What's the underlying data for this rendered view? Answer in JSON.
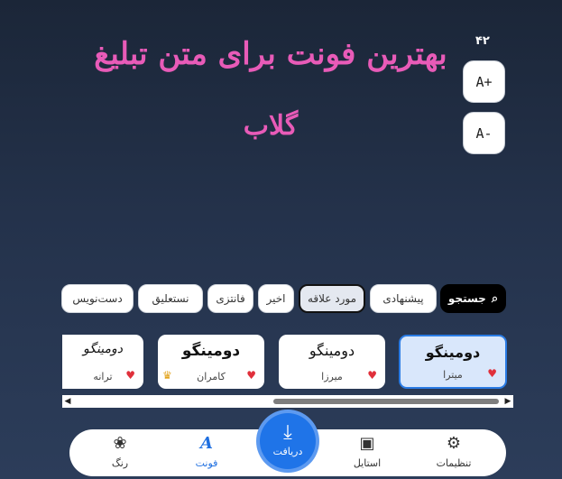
{
  "preview": {
    "title": "بهترین فونت برای متن تبلیغ",
    "subtitle": "گلاب",
    "text_color": "#e85bb8",
    "font_size_value": "۴۲"
  },
  "size_controls": {
    "increase_label": "A+",
    "decrease_label": "A-"
  },
  "filters": {
    "search_label": "جستجو",
    "chips": [
      "پیشنهادی",
      "مورد علاقه",
      "اخیر",
      "فانتزی",
      "نستعلیق",
      "دست‌نویس"
    ],
    "active_chip": "مورد علاقه"
  },
  "fonts": [
    {
      "sample": "دومینگو",
      "name": "میترا",
      "favorite": true,
      "selected": true
    },
    {
      "sample": "دومینگو",
      "name": "میرزا",
      "favorite": true
    },
    {
      "sample": "دومینگو",
      "name": "کامران",
      "favorite": true,
      "premium": true
    },
    {
      "sample": "دومینگو",
      "name": "ترانه",
      "favorite": true
    }
  ],
  "bottom_nav": {
    "items": [
      {
        "label": "تنظیمات",
        "icon": "gear-icon"
      },
      {
        "label": "استایل",
        "icon": "style-icon"
      },
      {
        "label": "فونت",
        "icon": "font-icon"
      },
      {
        "label": "رنگ",
        "icon": "palette-icon"
      }
    ],
    "active": "فونت",
    "download_label": "دریافت",
    "accent_color": "#1f74e8"
  }
}
